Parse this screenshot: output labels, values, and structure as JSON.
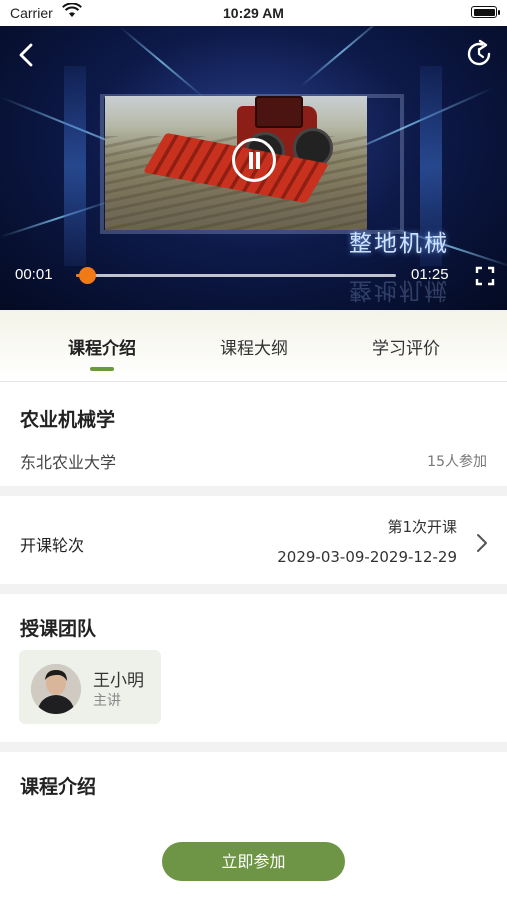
{
  "status_bar": {
    "carrier": "Carrier",
    "time": "10:29 AM"
  },
  "video": {
    "overlay_title": "整地机械",
    "current_time": "00:01",
    "duration": "01:25",
    "progress_fraction": 0.035
  },
  "tabs": [
    {
      "label": "课程介绍",
      "active": true
    },
    {
      "label": "课程大纲",
      "active": false
    },
    {
      "label": "学习评价",
      "active": false
    }
  ],
  "course": {
    "title": "农业机械学",
    "university": "东北农业大学",
    "participants": "15人参加"
  },
  "session": {
    "label": "开课轮次",
    "round": "第1次开课",
    "dates": "2029-03-09-2029-12-29"
  },
  "team": {
    "heading": "授课团队",
    "teacher": {
      "name": "王小明",
      "role": "主讲"
    }
  },
  "intro": {
    "heading": "课程介绍"
  },
  "actions": {
    "join_label": "立即参加"
  },
  "colors": {
    "accent": "#6e9545",
    "progress": "#f07b16",
    "indicator": "#6b9a3e"
  }
}
